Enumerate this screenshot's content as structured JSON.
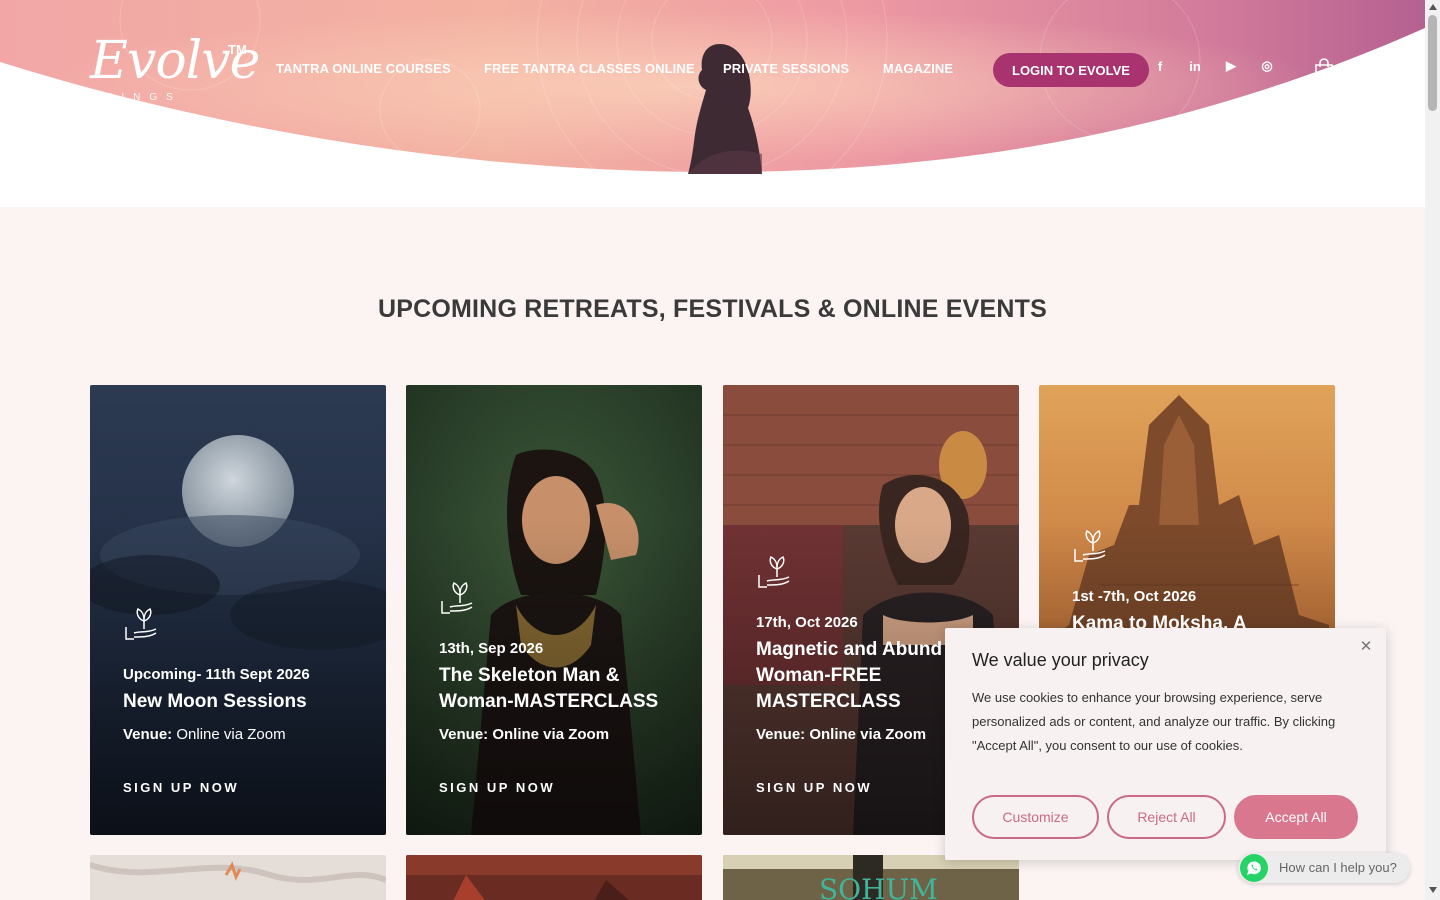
{
  "header": {
    "logo": {
      "word": "Evolve",
      "tm": "TM",
      "sub": "BEINGS"
    },
    "nav": [
      {
        "label": "TANTRA ONLINE COURSES"
      },
      {
        "label": "FREE TANTRA CLASSES ONLINE"
      },
      {
        "label": "PRIVATE SESSIONS"
      },
      {
        "label": "MAGAZINE"
      }
    ],
    "login_label": "LOGIN TO EVOLVE",
    "social": [
      {
        "icon": "facebook-icon",
        "glyph": "f"
      },
      {
        "icon": "linkedin-icon",
        "glyph": "in"
      },
      {
        "icon": "youtube-icon",
        "glyph": "▶"
      },
      {
        "icon": "instagram-icon",
        "glyph": "◎"
      }
    ],
    "cart_icon": "shopping-bag-icon"
  },
  "main": {
    "section_title": "UPCOMING RETREATS, FESTIVALS & ONLINE EVENTS",
    "events": [
      {
        "date": "Upcoming- 11th Sept 2026",
        "title": "New Moon Sessions",
        "venue_label": "Venue:",
        "venue_value": " Online via Zoom",
        "cta": "SIGN UP NOW"
      },
      {
        "date": "13th, Sep 2026",
        "title": "The Skeleton Man & Woman-MASTERCLASS",
        "venue_label": "Venue: Online via Zoom",
        "venue_value": "",
        "cta": "SIGN UP NOW"
      },
      {
        "date": "17th, Oct 2026",
        "title": "Magnetic and Abund Woman-FREE MASTERCLASS",
        "venue_label": "Venue: Online via Zoom",
        "venue_value": "",
        "cta": "SIGN UP NOW"
      },
      {
        "date": "1st -7th, Oct 2026",
        "title": "Kama to Moksha, A",
        "venue_label": "",
        "venue_value": "",
        "cta": ""
      }
    ],
    "partial_card_text": "SOHUM"
  },
  "cookie": {
    "title": "We value your privacy",
    "text": "We use cookies to enhance your browsing experience, serve personalized ads or content, and analyze our traffic. By clicking \"Accept All\", you consent to our use of cookies.",
    "customize": "Customize",
    "reject": "Reject All",
    "accept": "Accept All",
    "close_glyph": "✕"
  },
  "whatsapp": {
    "text": "How can I help you?"
  },
  "colors": {
    "brand": "#a8336e",
    "accept": "#d8778e",
    "outline": "#c96b86",
    "section_bg": "#fbf4f3"
  }
}
